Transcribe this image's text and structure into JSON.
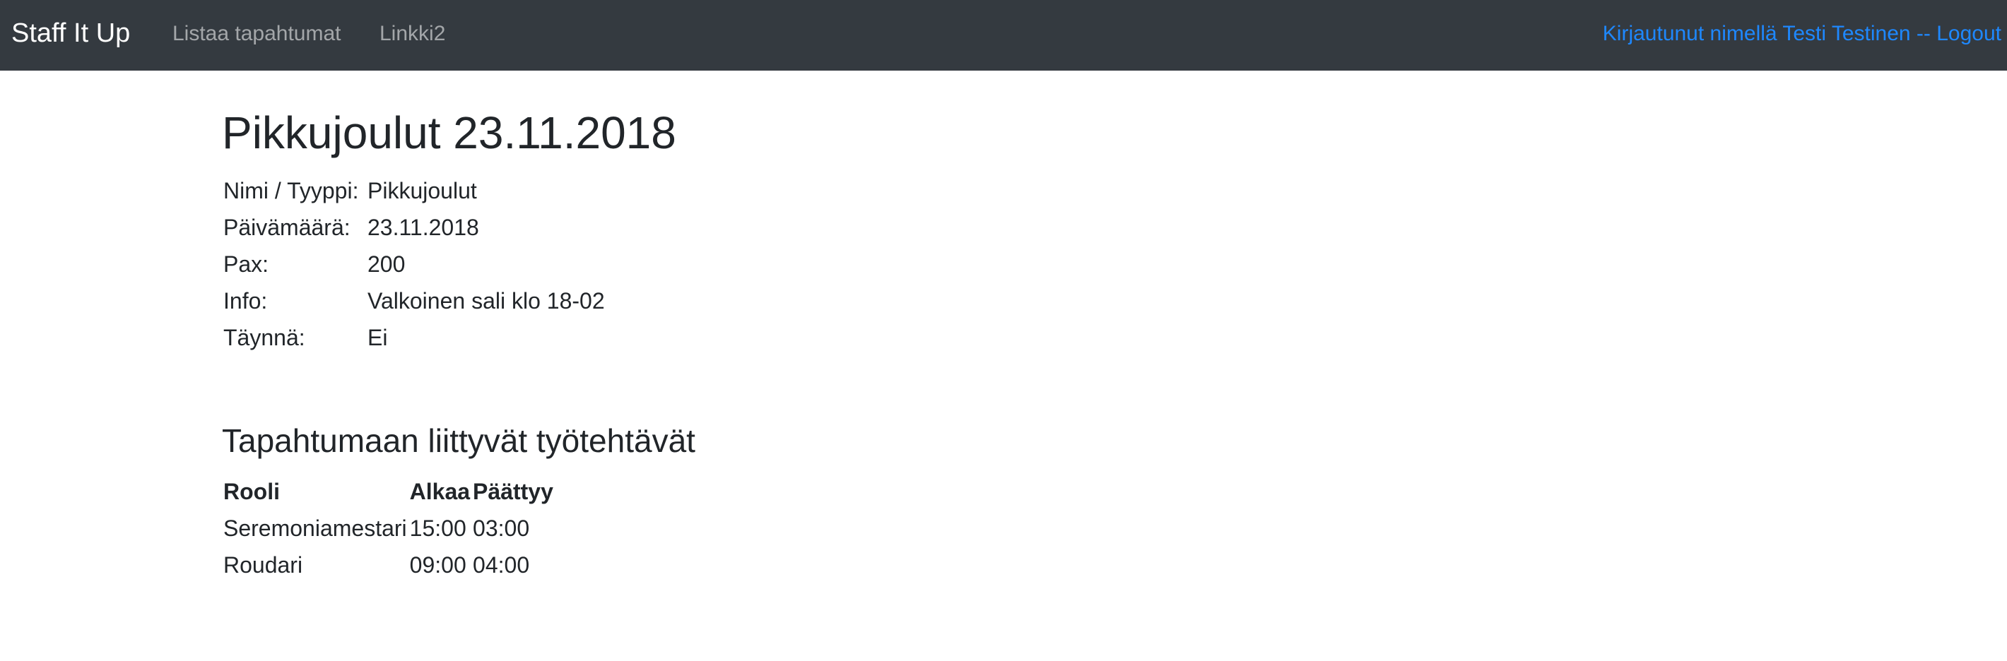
{
  "navbar": {
    "brand": "Staff It Up",
    "links": [
      "Listaa tapahtumat",
      "Linkki2"
    ],
    "login_text": "Kirjautunut nimellä Testi Testinen -- Logout"
  },
  "event": {
    "title": "Pikkujoulut 23.11.2018",
    "fields": [
      {
        "label": "Nimi / Tyyppi:",
        "value": "Pikkujoulut"
      },
      {
        "label": "Päivämäärä:",
        "value": "23.11.2018"
      },
      {
        "label": "Pax:",
        "value": "200"
      },
      {
        "label": "Info:",
        "value": "Valkoinen sali klo 18-02"
      },
      {
        "label": "Täynnä:",
        "value": "Ei"
      }
    ]
  },
  "tasks": {
    "heading": "Tapahtumaan liittyvät työtehtävät",
    "columns": [
      "Rooli",
      "Alkaa",
      "Päättyy"
    ],
    "rows": [
      [
        "Seremoniamestari",
        "15:00",
        "03:00"
      ],
      [
        "Roudari",
        "09:00",
        "04:00"
      ]
    ]
  },
  "colors": {
    "navbar_bg": "#343a40",
    "link_accent": "#1e88ff",
    "text": "#212529"
  }
}
